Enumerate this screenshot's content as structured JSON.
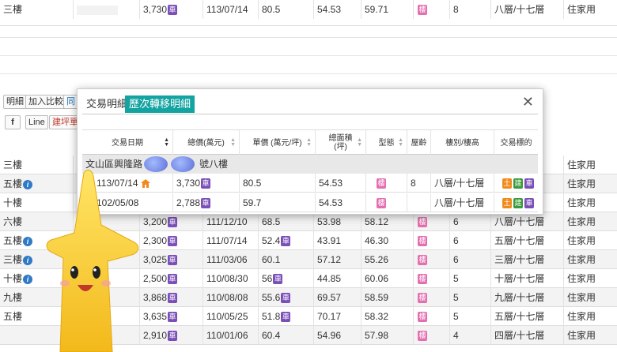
{
  "top_row": {
    "floor": "三樓",
    "community": "",
    "total": "3,730",
    "date": "113/07/14",
    "unit_price": "80.5",
    "area": "54.53",
    "main_area": "59.71",
    "age": "8",
    "floors": "八層/十七層",
    "use": "住家用"
  },
  "toolbar": {
    "detail": "明細",
    "compare": "加入比較",
    "same": "同",
    "fb": "f",
    "line": "Line",
    "price_calc": "建坪單價"
  },
  "modal": {
    "tab_plain": "交易明細",
    "tab_active": "歷次轉移明細",
    "close": "✕",
    "headers": {
      "date": "交易日期",
      "total": "總價(萬元)",
      "unit": "單價 (萬元/坪)",
      "area": "總面積\n(坪)",
      "type": "型態",
      "age": "屋齡",
      "floors": "樓別/樓高",
      "target": "交易標的"
    },
    "group_label": "文山區興隆路",
    "group_suffix": "號八樓",
    "rows": [
      {
        "date": "113/07/14",
        "total": "3,730",
        "unit": "80.5",
        "area": "54.53",
        "age": "8",
        "floors": "八層/十七層"
      },
      {
        "date": "102/05/08",
        "total": "2,788",
        "unit": "59.7",
        "area": "54.53",
        "age": "",
        "floors": "八層/十七層"
      }
    ]
  },
  "badges": {
    "car": "車",
    "building": "樓",
    "land": "土",
    "build": "建"
  },
  "bg_rows": [
    {
      "floor": "三樓",
      "info": false,
      "total": "",
      "date": "",
      "unit": "",
      "area": "",
      "main": "",
      "age": "",
      "floors": "",
      "use": "住家用"
    },
    {
      "floor": "五樓",
      "info": true,
      "total": "",
      "date": "",
      "unit": "",
      "area": "",
      "main": "",
      "age": "",
      "floors": "",
      "use": "住家用"
    },
    {
      "floor": "十樓",
      "info": false,
      "total": "",
      "date": "",
      "unit": "",
      "area": "",
      "main": "",
      "age": "",
      "floors": "",
      "use": "住家用"
    },
    {
      "floor": "六樓",
      "info": false,
      "total": "3,200",
      "date": "111/12/10",
      "unit": "68.5",
      "area": "53.98",
      "main": "58.12",
      "age": "6",
      "floors": "八層/十七層",
      "use": "住家用"
    },
    {
      "floor": "五樓",
      "info": true,
      "total": "2,300",
      "date": "111/07/14",
      "unit": "52.4",
      "area": "43.91",
      "main": "46.30",
      "age": "6",
      "floors": "五層/十七層",
      "use": "住家用"
    },
    {
      "floor": "三樓",
      "info": true,
      "total": "3,025",
      "date": "111/03/06",
      "unit": "60.1",
      "area": "57.12",
      "main": "55.26",
      "age": "6",
      "floors": "三層/十七層",
      "use": "住家用"
    },
    {
      "floor": "十樓",
      "info": true,
      "total": "2,500",
      "date": "110/08/30",
      "unit": "56",
      "area": "44.85",
      "main": "60.06",
      "age": "5",
      "floors": "十層/十七層",
      "use": "住家用"
    },
    {
      "floor": "九樓",
      "info": false,
      "total": "3,868",
      "date": "110/08/08",
      "unit": "55.6",
      "area": "69.57",
      "main": "58.59",
      "age": "5",
      "floors": "九層/十七層",
      "use": "住家用"
    },
    {
      "floor": "五樓",
      "info": false,
      "total": "3,635",
      "date": "110/05/25",
      "unit": "51.8",
      "area": "70.17",
      "main": "58.32",
      "age": "5",
      "floors": "五層/十七層",
      "use": "住家用"
    },
    {
      "floor": "",
      "info": false,
      "total": "2,910",
      "date": "110/01/06",
      "unit": "60.4",
      "area": "54.96",
      "main": "57.98",
      "age": "4",
      "floors": "四層/十七層",
      "use": "住家用"
    }
  ]
}
